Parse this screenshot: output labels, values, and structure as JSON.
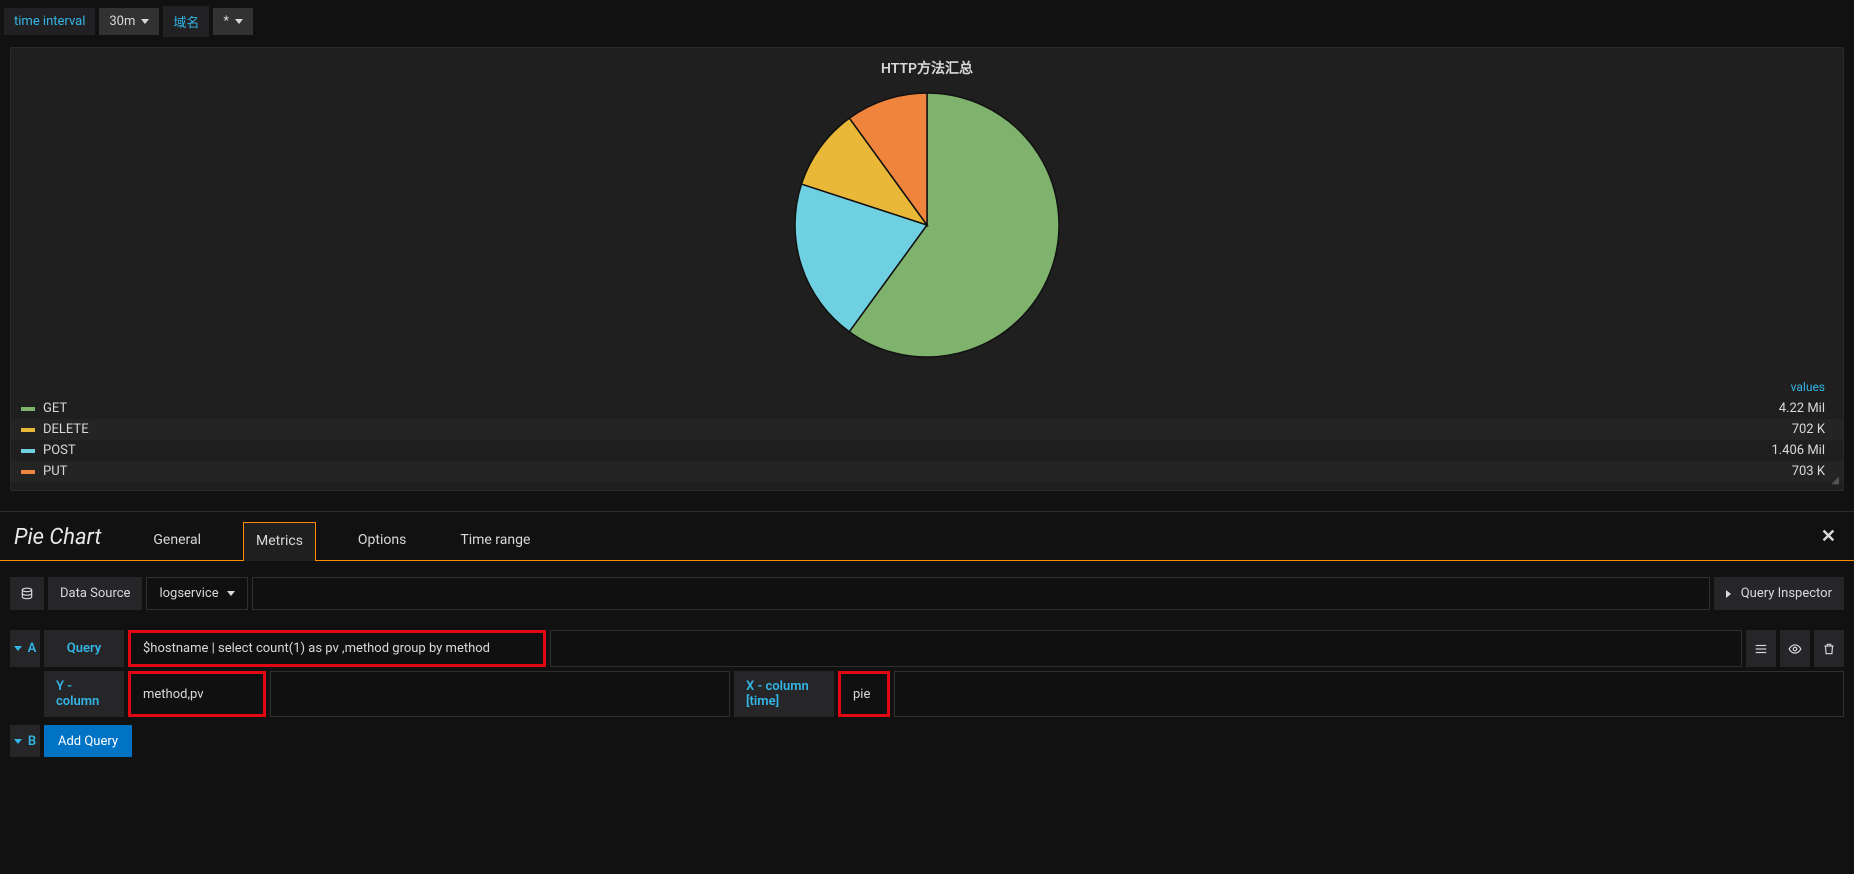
{
  "toolbar": {
    "time_interval_label": "time interval",
    "time_interval_value": "30m",
    "domain_label": "域名",
    "domain_value": "*"
  },
  "panel": {
    "title": "HTTP方法汇总",
    "values_header": "values"
  },
  "chart_data": {
    "type": "pie",
    "series": [
      {
        "name": "GET",
        "value": 4220000,
        "display": "4.22 Mil",
        "color": "#7eb26d"
      },
      {
        "name": "DELETE",
        "value": 702000,
        "display": "702 K",
        "color": "#eab839"
      },
      {
        "name": "POST",
        "value": 1406000,
        "display": "1.406 Mil",
        "color": "#6ed0e0"
      },
      {
        "name": "PUT",
        "value": 703000,
        "display": "703 K",
        "color": "#ef843c"
      }
    ]
  },
  "editor": {
    "title": "Pie Chart",
    "tabs": {
      "general": "General",
      "metrics": "Metrics",
      "options": "Options",
      "time_range": "Time range"
    }
  },
  "datasource": {
    "label": "Data Source",
    "value": "logservice",
    "inspector": "Query Inspector"
  },
  "query_a": {
    "letter": "A",
    "query_label": "Query",
    "query_value": "$hostname | select count(1) as pv ,method group by method",
    "y_label": "Y - column",
    "y_value": "method,pv",
    "x_label": "X - column [time]",
    "x_value": "pie"
  },
  "query_b": {
    "letter": "B",
    "add_label": "Add Query"
  }
}
